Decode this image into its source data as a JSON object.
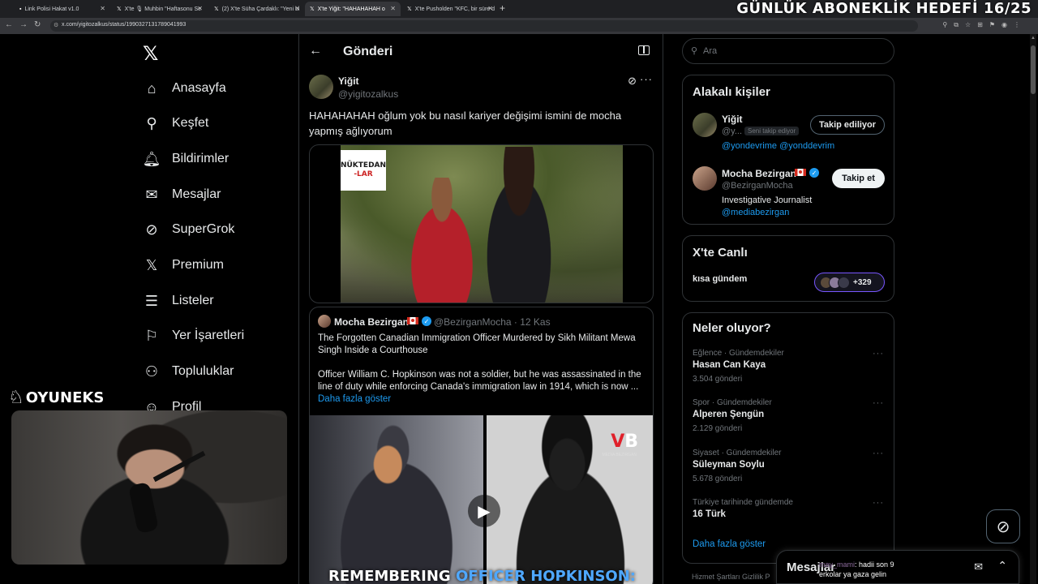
{
  "browser": {
    "tabs": [
      {
        "label": "Link Polisi Hakat v1.0",
        "icon": "page-icon"
      },
      {
        "label": "X'te 🎙 Muhbin \"Haftasonu Se",
        "icon": "x-icon"
      },
      {
        "label": "(2) X'te Süha Çardaklı: \"Yeni bi",
        "icon": "x-icon"
      },
      {
        "label": "X'te Yiğit: \"HAHAHAHAH o",
        "icon": "x-icon",
        "active": true
      },
      {
        "label": "X'te Pusholden \"KFC, bir süre d",
        "icon": "x-icon"
      }
    ],
    "new_tab": "+",
    "url": "x.com/yigitozalkus/status/1990327131789041993",
    "stream_goal": "GÜNLÜK ABONEKLİK HEDEFİ 16/25"
  },
  "nav": {
    "logo": "𝕏",
    "items": [
      {
        "label": "Anasayfa",
        "icon": "home-icon",
        "glyph": "⌂"
      },
      {
        "label": "Keşfet",
        "icon": "search-icon",
        "glyph": "⚲"
      },
      {
        "label": "Bildirimler",
        "icon": "bell-icon",
        "glyph": "🔔︎"
      },
      {
        "label": "Mesajlar",
        "icon": "mail-icon",
        "glyph": "✉"
      },
      {
        "label": "SuperGrok",
        "icon": "grok-icon",
        "glyph": "⊘"
      },
      {
        "label": "Premium",
        "icon": "x-premium-icon",
        "glyph": "𝕏"
      },
      {
        "label": "Listeler",
        "icon": "list-icon",
        "glyph": "☰"
      },
      {
        "label": "Yer İşaretleri",
        "icon": "bookmark-icon",
        "glyph": "⚐"
      },
      {
        "label": "Topluluklar",
        "icon": "communities-icon",
        "glyph": "⚇"
      },
      {
        "label": "Profil",
        "icon": "profile-icon",
        "glyph": "☺"
      }
    ]
  },
  "post": {
    "header_title": "Gönderi",
    "author_name": "Yiğit",
    "author_handle": "@yigitozalkus",
    "text": "HAHAHAHAH oğlum yok bu nasıl kariyer değişimi ismini de mocha yapmış ağlıyorum",
    "media_watermark_line1": "NÜKTEDAN",
    "media_watermark_line2": "-LAR"
  },
  "quote": {
    "author_name": "Mocha Bezirgan",
    "meta": "@BezirganMocha · 12 Kas",
    "title": "The Forgotten Canadian Immigration Officer Murdered by Sikh Militant Mewa Singh Inside a Courthouse",
    "body": "Officer William C. Hopkinson was not a soldier, but he was assassinated in the line of duty while enforcing Canada's immigration law in 1914, which is now ...",
    "show_more": "Daha fazla göster",
    "media_logo": "B",
    "media_logo_sub": "MEDIA BEZIRGAN",
    "caption_part1": "REMEMBERING ",
    "caption_part2": "OFFICER HOPKINSON:"
  },
  "sidebar": {
    "search_placeholder": "Ara",
    "related": {
      "title": "Alakalı kişiler",
      "people": [
        {
          "name": "Yiğit",
          "handle": "@y...",
          "badge": "Seni takip ediyor",
          "links": "@yondevrime @yonddevrim",
          "button": "Takip ediliyor"
        },
        {
          "name": "Mocha Bezirgan",
          "handle": "@BezirganMocha",
          "bio": "Investigative Journalist",
          "links": "@mediabezirgan",
          "button": "Takip et"
        }
      ]
    },
    "live": {
      "title": "X'te Canlı",
      "space_title": "kısa gündem",
      "count": "+329"
    },
    "trends": {
      "title": "Neler oluyor?",
      "items": [
        {
          "category": "Eğlence · Gündemdekiler",
          "name": "Hasan Can Kaya",
          "count": "3.504 gönderi"
        },
        {
          "category": "Spor · Gündemdekiler",
          "name": "Alperen Şengün",
          "count": "2.129 gönderi"
        },
        {
          "category": "Siyaset · Gündemdekiler",
          "name": "Süleyman Soylu",
          "count": "5.678 gönderi"
        },
        {
          "category": "Türkiye tarihinde gündemde",
          "name": "16 Türk",
          "count": ""
        }
      ],
      "show_more": "Daha fazla göster"
    },
    "footer": "Hizmet Şartları    Gizlilik P"
  },
  "messages": {
    "title": "Mesajlar"
  },
  "stream": {
    "brand": "OYUNEKS",
    "chat_user": "may_mami",
    "chat_line1": ": hadii son 9",
    "chat_line2": "erkolar ya gaza gelin"
  }
}
